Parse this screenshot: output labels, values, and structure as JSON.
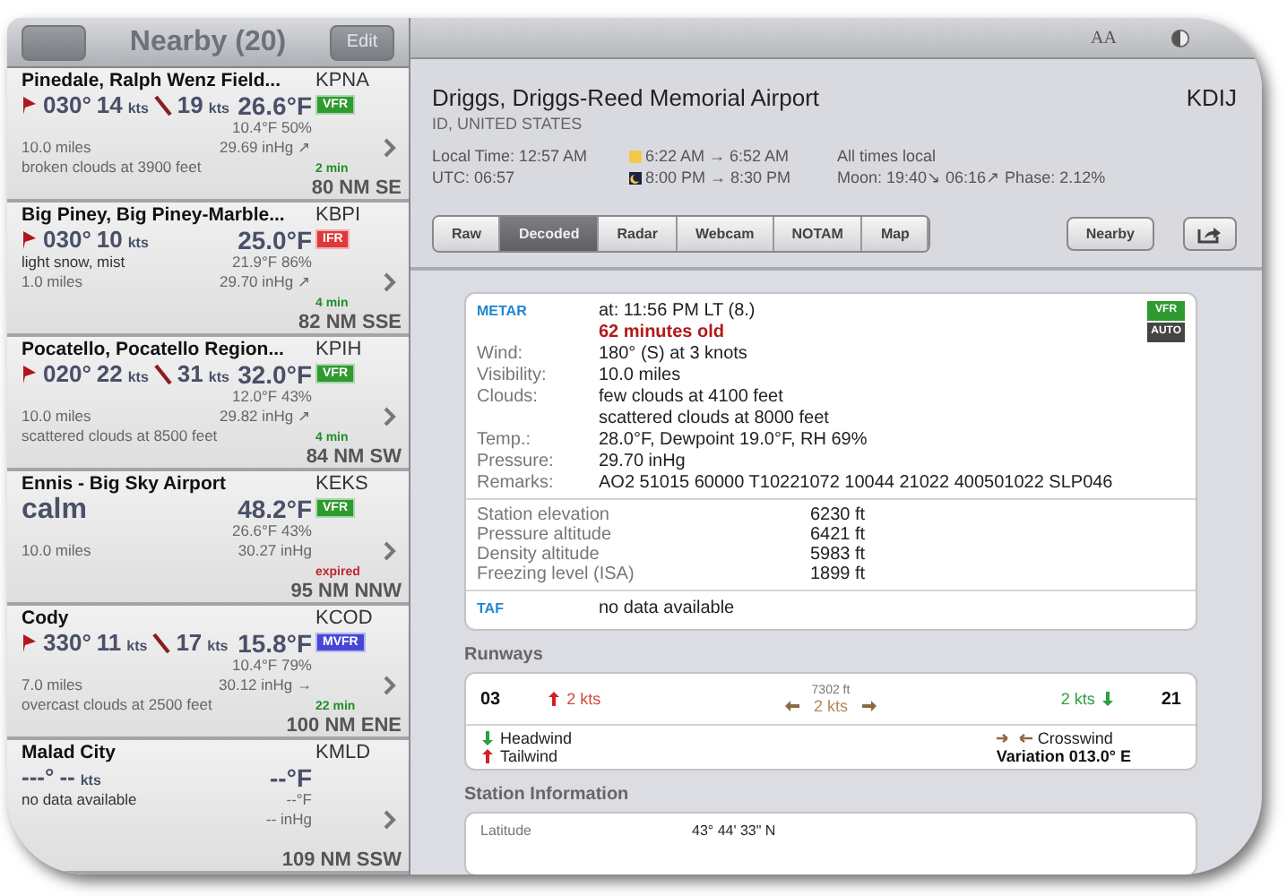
{
  "sidebar": {
    "title": "Nearby (20)",
    "edit_button": "Edit",
    "stations": [
      {
        "name": "Pinedale, Ralph Wenz Field...",
        "ident": "KPNA",
        "wind": {
          "kind": "reported",
          "direction": "030°",
          "speed": "14",
          "speed_unit": "kts",
          "gust": "19",
          "gust_unit": "kts"
        },
        "temperature": "26.6°F",
        "category": {
          "label": "VFR",
          "color": "#2f9a2f"
        },
        "visibility": "10.0 miles",
        "clouds": "broken clouds at 3900 feet",
        "dewpoint": "10.4°F 50%",
        "pressure": "29.69 inHg ↗",
        "age": {
          "text": "2 min",
          "color": "#1f8f2a"
        },
        "distance": "80 NM SE"
      },
      {
        "name": "Big Piney, Big Piney-Marble...",
        "ident": "KBPI",
        "wind": {
          "kind": "reported",
          "direction": "030°",
          "speed": "10",
          "speed_unit": "kts"
        },
        "temperature": "25.0°F",
        "category": {
          "label": "IFR",
          "color": "#e0393b"
        },
        "weather": "light snow, mist",
        "visibility": "1.0 miles",
        "dewpoint": "21.9°F 86%",
        "pressure": "29.70 inHg ↗",
        "age": {
          "text": "4 min",
          "color": "#1f8f2a"
        },
        "distance": "82 NM SSE"
      },
      {
        "name": "Pocatello, Pocatello Region...",
        "ident": "KPIH",
        "wind": {
          "kind": "reported",
          "direction": "020°",
          "speed": "22",
          "speed_unit": "kts",
          "gust": "31",
          "gust_unit": "kts"
        },
        "temperature": "32.0°F",
        "category": {
          "label": "VFR",
          "color": "#2f9a2f"
        },
        "visibility": "10.0 miles",
        "clouds": "scattered clouds at 8500 feet",
        "dewpoint": "12.0°F 43%",
        "pressure": "29.82 inHg ↗",
        "age": {
          "text": "4 min",
          "color": "#1f8f2a"
        },
        "distance": "84 NM SW"
      },
      {
        "name": "Ennis - Big Sky Airport",
        "ident": "KEKS",
        "wind": {
          "kind": "calm",
          "text": "calm"
        },
        "temperature": "48.2°F",
        "category": {
          "label": "VFR",
          "color": "#2f9a2f"
        },
        "visibility": "10.0 miles",
        "dewpoint": "26.6°F 43%",
        "pressure": "30.27 inHg",
        "age": {
          "text": "expired",
          "color": "#c0262b"
        },
        "distance": "95 NM NNW"
      },
      {
        "name": "Cody",
        "ident": "KCOD",
        "wind": {
          "kind": "reported",
          "direction": "330°",
          "speed": "11",
          "speed_unit": "kts",
          "gust": "17",
          "gust_unit": "kts"
        },
        "temperature": "15.8°F",
        "category": {
          "label": "MVFR",
          "color": "#4747d6"
        },
        "visibility": "7.0 miles",
        "clouds": "overcast clouds at 2500 feet",
        "dewpoint": "10.4°F 79%",
        "pressure": "30.12 inHg →",
        "age": {
          "text": "22 min",
          "color": "#1f8f2a"
        },
        "distance": "100 NM ENE"
      },
      {
        "name": "Malad City",
        "ident": "KMLD",
        "wind": {
          "kind": "missing",
          "direction": "---°",
          "speed": "--",
          "speed_unit": "kts"
        },
        "temperature": "--°F",
        "weather": "no data available",
        "dewpoint": "--°F",
        "pressure": "-- inHg",
        "distance": "109 NM SSW"
      }
    ]
  },
  "header": {
    "text_size_button": "AA"
  },
  "info": {
    "name": "Driggs, Driggs-Reed Memorial Airport",
    "ident": "KDIJ",
    "region": "ID, UNITED STATES",
    "local_time": "Local Time: 12:57 AM",
    "utc": "UTC: 06:57",
    "sunrise": "6:22 AM → 6:52 AM",
    "sunset": "8:00 PM → 8:30 PM",
    "times_note": "All times local",
    "moon": "Moon: 19:40↘  06:16↗ Phase: 2.12%",
    "tabs": [
      {
        "label": "Raw",
        "selected": false
      },
      {
        "label": "Decoded",
        "selected": true
      },
      {
        "label": "Radar",
        "selected": false
      },
      {
        "label": "Webcam",
        "selected": false
      },
      {
        "label": "NOTAM",
        "selected": false
      },
      {
        "label": "Map",
        "selected": false
      }
    ],
    "nearby_button": "Nearby"
  },
  "metar": {
    "label": "METAR",
    "time": "at: 11:56 PM LT (8.)",
    "age": "62 minutes old",
    "badges": [
      {
        "label": "VFR",
        "color": "#2f9a2f"
      },
      {
        "label": "AUTO",
        "color": "#444444"
      }
    ],
    "rows": [
      {
        "label": "Wind:",
        "values": [
          "180° (S) at 3 knots"
        ]
      },
      {
        "label": "Visibility:",
        "values": [
          "10.0 miles"
        ]
      },
      {
        "label": "Clouds:",
        "values": [
          "few clouds at 4100 feet",
          "scattered clouds at 8000 feet"
        ]
      },
      {
        "label": "Temp.:",
        "values": [
          "28.0°F, Dewpoint 19.0°F, RH 69%"
        ]
      },
      {
        "label": "Pressure:",
        "values": [
          "29.70 inHg"
        ]
      },
      {
        "label": "Remarks:",
        "values": [
          "AO2 51015 60000 T10221072 10044 21022 400501022 SLP046"
        ]
      }
    ],
    "derived": [
      {
        "label": "Station elevation",
        "value": "6230 ft"
      },
      {
        "label": "Pressure altitude",
        "value": "6421 ft"
      },
      {
        "label": "Density altitude",
        "value": "5983 ft"
      },
      {
        "label": "Freezing level (ISA)",
        "value": "1899 ft"
      }
    ],
    "taf_label": "TAF",
    "taf_value": "no data available"
  },
  "runways": {
    "title": "Runways",
    "left_end": "03",
    "tailwind": "2 kts",
    "length": "7302 ft",
    "crosswind": "2 kts",
    "headwind": "2 kts",
    "right_end": "21",
    "legend_headwind": "Headwind",
    "legend_tailwind": "Tailwind",
    "legend_crosswind": "Crosswind",
    "variation": "Variation 013.0° E"
  },
  "station_info": {
    "title": "Station Information",
    "rows": [
      {
        "label": "Latitude",
        "value": "43° 44' 33\" N"
      }
    ]
  }
}
